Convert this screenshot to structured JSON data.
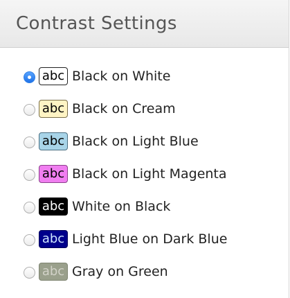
{
  "header": {
    "title": "Contrast Settings"
  },
  "options": [
    {
      "label": "Black on White",
      "swatch_text": "abc",
      "fg": "#000000",
      "bg": "#ffffff",
      "border": "#222222",
      "selected": true
    },
    {
      "label": "Black on Cream",
      "swatch_text": "abc",
      "fg": "#000000",
      "bg": "#fff4c4",
      "border": "#7a6f4a",
      "selected": false
    },
    {
      "label": "Black on Light Blue",
      "swatch_text": "abc",
      "fg": "#000000",
      "bg": "#a8d4e8",
      "border": "#4a6f82",
      "selected": false
    },
    {
      "label": "Black on Light Magenta",
      "swatch_text": "abc",
      "fg": "#000000",
      "bg": "#f07ef0",
      "border": "#8a3f8a",
      "selected": false
    },
    {
      "label": "White on Black",
      "swatch_text": "abc",
      "fg": "#ffffff",
      "bg": "#000000",
      "border": "#000000",
      "selected": false
    },
    {
      "label": "Light Blue on Dark Blue",
      "swatch_text": "abc",
      "fg": "#cfe6ff",
      "bg": "#00008b",
      "border": "#00005a",
      "selected": false
    },
    {
      "label": "Gray on Green",
      "swatch_text": "abc",
      "fg": "#d2d2c8",
      "bg": "#9aa08c",
      "border": "#7f8572",
      "selected": false
    }
  ]
}
